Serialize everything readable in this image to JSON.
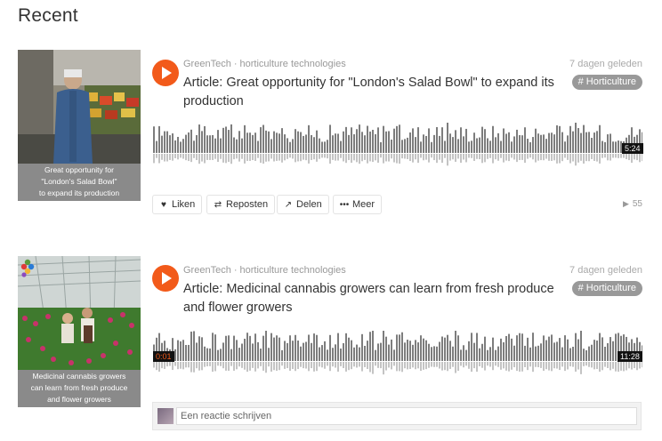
{
  "heading": "Recent",
  "tracks": [
    {
      "uploader": "GreenTech",
      "separator": "·",
      "subtitle": "horticulture technologies",
      "title": "Article: Great opportunity for \"London's Salad Bowl\" to expand its production",
      "date": "7 dagen geleden",
      "tag": "# Horticulture",
      "caption_lines": [
        "Great opportunity for",
        "\"London's Salad Bowl\"",
        "to expand its production"
      ],
      "duration": "5:24",
      "actions": {
        "like": "Liken",
        "repost": "Reposten",
        "share": "Delen",
        "more": "Meer"
      },
      "plays": "55"
    },
    {
      "uploader": "GreenTech",
      "separator": "·",
      "subtitle": "horticulture technologies",
      "title": "Article: Medicinal cannabis growers can learn from fresh produce and flower growers",
      "date": "7 dagen geleden",
      "tag": "# Horticulture",
      "caption_lines": [
        "Medicinal cannabis growers",
        "can learn from fresh produce",
        "and flower growers"
      ],
      "elapsed": "0:01",
      "duration": "11:28"
    }
  ],
  "comment": {
    "placeholder": "Een reactie schrijven"
  },
  "colors": {
    "accent": "#f25a1a",
    "waveform": "#7d7d7d",
    "tag_bg": "#999999"
  },
  "icons": {
    "play": "play-icon",
    "like": "heart-icon",
    "repost": "repost-icon",
    "share": "share-icon",
    "more": "more-icon",
    "plays": "play-count-icon"
  }
}
